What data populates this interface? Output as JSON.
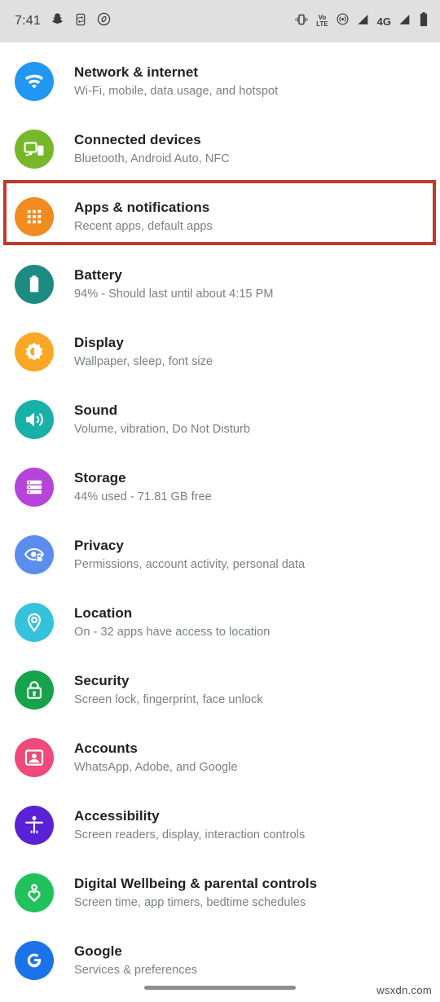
{
  "status_bar": {
    "clock": "7:41",
    "left_icons": [
      "snapchat-icon",
      "screen-record-icon",
      "shazam-icon"
    ],
    "right_icons": [
      "vibrate-icon",
      "volte-icon",
      "hotspot-icon",
      "signal-bar-1-icon",
      "4g-label",
      "signal-bar-2-icon",
      "battery-icon"
    ],
    "volte_top": "Vo",
    "volte_bottom": "LTE",
    "network_type": "4G",
    "background": "#e0e0e0"
  },
  "highlight": {
    "color": "#c0392b",
    "target": "Apps & notifications"
  },
  "settings": {
    "items": [
      {
        "title": "Network & internet",
        "subtitle": "Wi-Fi, mobile, data usage, and hotspot",
        "icon": "wifi-icon",
        "color": "#2196f3"
      },
      {
        "title": "Connected devices",
        "subtitle": "Bluetooth, Android Auto, NFC",
        "icon": "cast-devices-icon",
        "color": "#76b82a"
      },
      {
        "title": "Apps & notifications",
        "subtitle": "Recent apps, default apps",
        "icon": "apps-grid-icon",
        "color": "#f28b20"
      },
      {
        "title": "Battery",
        "subtitle": "94% - Should last until about 4:15 PM",
        "icon": "battery-icon",
        "color": "#1d8b82"
      },
      {
        "title": "Display",
        "subtitle": "Wallpaper, sleep, font size",
        "icon": "brightness-icon",
        "color": "#f9a825"
      },
      {
        "title": "Sound",
        "subtitle": "Volume, vibration, Do Not Disturb",
        "icon": "volume-icon",
        "color": "#19b0a8"
      },
      {
        "title": "Storage",
        "subtitle": "44% used - 71.81 GB free",
        "icon": "storage-stack-icon",
        "color": "#b744d8"
      },
      {
        "title": "Privacy",
        "subtitle": "Permissions, account activity, personal data",
        "icon": "eye-lock-icon",
        "color": "#5b8def"
      },
      {
        "title": "Location",
        "subtitle": "On - 32 apps have access to location",
        "icon": "location-pin-icon",
        "color": "#35c2dd"
      },
      {
        "title": "Security",
        "subtitle": "Screen lock, fingerprint, face unlock",
        "icon": "lock-icon",
        "color": "#16a34a"
      },
      {
        "title": "Accounts",
        "subtitle": "WhatsApp, Adobe, and Google",
        "icon": "account-card-icon",
        "color": "#ef4a7b"
      },
      {
        "title": "Accessibility",
        "subtitle": "Screen readers, display, interaction controls",
        "icon": "accessibility-person-icon",
        "color": "#5b21d6"
      },
      {
        "title": "Digital Wellbeing & parental controls",
        "subtitle": "Screen time, app timers, bedtime schedules",
        "icon": "wellbeing-heart-icon",
        "color": "#21c25b"
      },
      {
        "title": "Google",
        "subtitle": "Services & preferences",
        "icon": "google-g-icon",
        "color": "#1a73e8"
      }
    ]
  },
  "watermark": "wsxdn.com"
}
